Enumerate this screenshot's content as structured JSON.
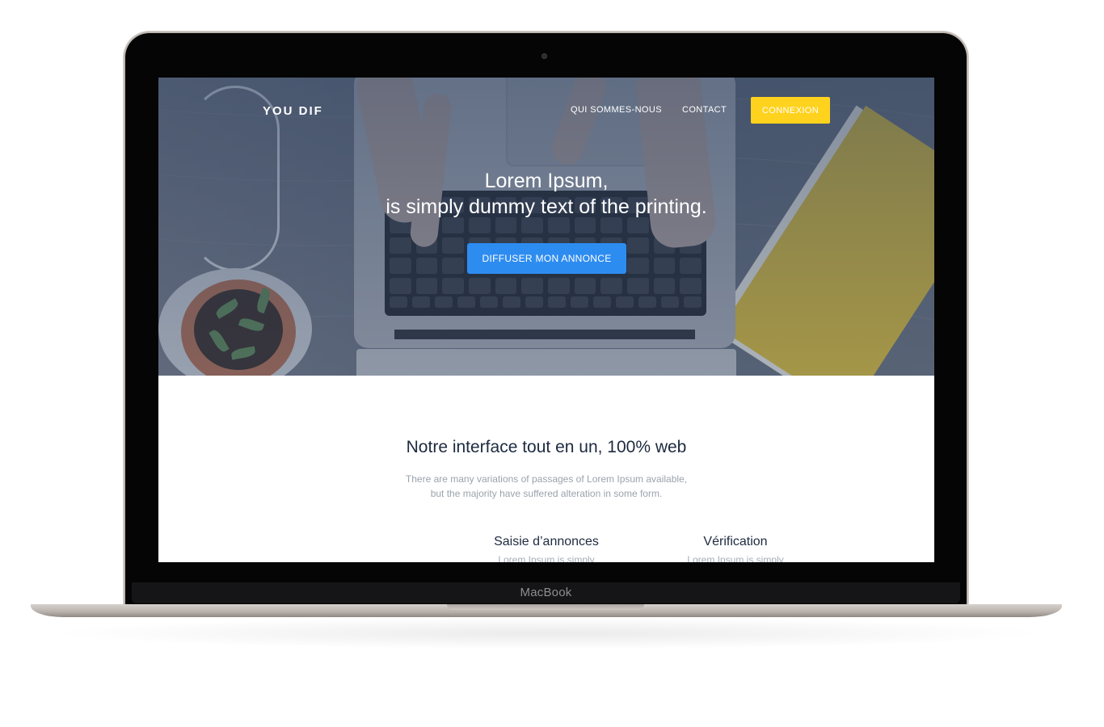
{
  "device": {
    "brand_label": "MacBook"
  },
  "header": {
    "logo": "YOU DIF",
    "nav": [
      {
        "label": "QUI SOMMES-NOUS"
      },
      {
        "label": "CONTACT"
      }
    ],
    "login_label": "CONNEXION"
  },
  "hero": {
    "title_line1": "Lorem Ipsum,",
    "title_line2": "is simply dummy text of the printing.",
    "cta_label": "DIFFUSER MON ANNONCE"
  },
  "section": {
    "title": "Notre interface tout en un, 100% web",
    "text_line1": "There are many variations of passages of Lorem Ipsum available,",
    "text_line2": "but the majority have suffered alteration in some form."
  },
  "features": [
    {
      "title": "Saisie d’annonces",
      "text": "Lorem Ipsum is simply"
    },
    {
      "title": "Vérification",
      "text": "Lorem Ipsum is simply"
    }
  ],
  "colors": {
    "accent_yellow": "#ffd21e",
    "accent_blue": "#2d8cf0",
    "heading": "#1d2a3f",
    "muted": "#9aa3ad"
  }
}
